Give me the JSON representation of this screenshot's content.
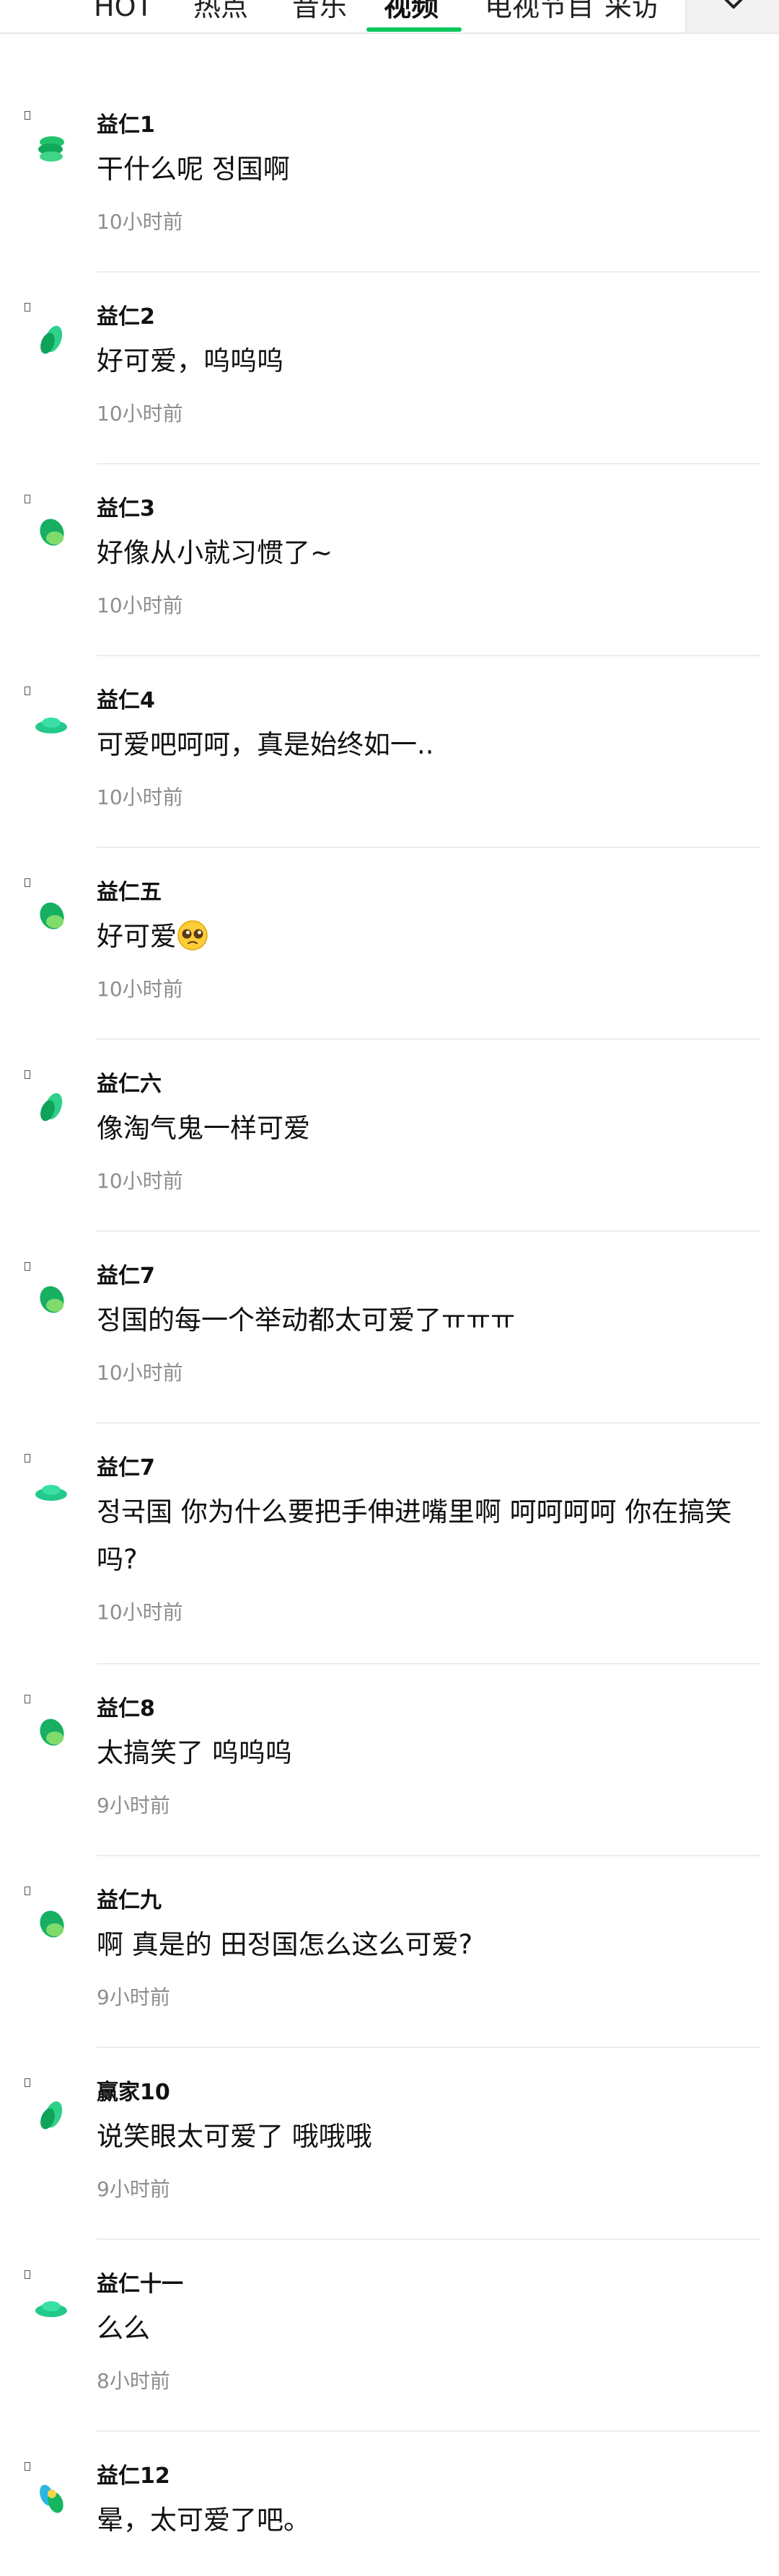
{
  "tabs": [
    {
      "label": "HOT",
      "active": false
    },
    {
      "label": "热点",
      "active": false
    },
    {
      "label": "音乐",
      "active": false
    },
    {
      "label": "视频",
      "active": true
    },
    {
      "label": "电视节目",
      "active": false
    },
    {
      "label": "采访",
      "active": false
    }
  ],
  "more_icon": "chevron-down-icon",
  "accent_color": "#03c75a",
  "comments": [
    {
      "name": "益仁1",
      "text": "干什么呢 정国啊",
      "time": "10小时前",
      "avatar": "stack"
    },
    {
      "name": "益仁2",
      "text": "好可爱，呜呜呜",
      "time": "10小时前",
      "avatar": "leaf"
    },
    {
      "name": "益仁3",
      "text": "好像从小就习惯了~",
      "time": "10小时前",
      "avatar": "leaf-dark"
    },
    {
      "name": "益仁4",
      "text": "可爱吧呵呵，真是始终如一..",
      "time": "10小时前",
      "avatar": "dish"
    },
    {
      "name": "益仁五",
      "text": "好可爱",
      "time": "10小时前",
      "avatar": "leaf-dark",
      "emoji": "pleading-face-emoji"
    },
    {
      "name": "益仁六",
      "text": "像淘气鬼一样可爱",
      "time": "10小时前",
      "avatar": "leaf"
    },
    {
      "name": "益仁7",
      "text": "정国的每一个举动都太可爱了ㅠㅠㅠ",
      "time": "10小时前",
      "avatar": "leaf-dark"
    },
    {
      "name": "益仁7",
      "text": "정국国 你为什么要把手伸进嘴里啊 呵呵呵呵 你在搞笑吗?",
      "time": "10小时前",
      "avatar": "dish"
    },
    {
      "name": "益仁8",
      "text": "太搞笑了 呜呜呜",
      "time": "9小时前",
      "avatar": "leaf-dark"
    },
    {
      "name": "益仁九",
      "text": "啊 真是的 田정国怎么这么可爱?",
      "time": "9小时前",
      "avatar": "leaf-dark"
    },
    {
      "name": "赢家10",
      "text": "说笑眼太可爱了 哦哦哦",
      "time": "9小时前",
      "avatar": "leaf"
    },
    {
      "name": "益仁十一",
      "text": "么么",
      "time": "8小时前",
      "avatar": "dish"
    },
    {
      "name": "益仁12",
      "text": "晕，太可爱了吧。",
      "time": "",
      "avatar": "duo"
    }
  ]
}
